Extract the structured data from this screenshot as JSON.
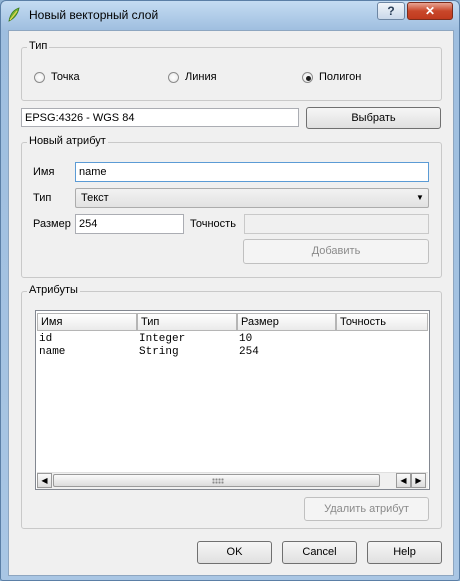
{
  "window": {
    "title": "Новый векторный слой"
  },
  "type_group": {
    "title": "Тип",
    "options": [
      {
        "label": "Точка",
        "selected": false
      },
      {
        "label": "Линия",
        "selected": false
      },
      {
        "label": "Полигон",
        "selected": true
      }
    ]
  },
  "crs": {
    "value": "EPSG:4326 - WGS 84",
    "select_label": "Выбрать"
  },
  "new_attribute": {
    "title": "Новый атрибут",
    "name_label": "Имя",
    "name_value": "name",
    "type_label": "Тип",
    "type_value": "Текст",
    "size_label": "Размер",
    "size_value": "254",
    "precision_label": "Точность",
    "precision_value": "",
    "add_label": "Добавить"
  },
  "attributes": {
    "title": "Атрибуты",
    "columns": [
      "Имя",
      "Тип",
      "Размер",
      "Точность"
    ],
    "rows": [
      [
        "id",
        "Integer",
        "10",
        ""
      ],
      [
        "name",
        "String",
        "254",
        ""
      ]
    ],
    "delete_label": "Удалить атрибут"
  },
  "buttons": {
    "ok": "OK",
    "cancel": "Cancel",
    "help": "Help"
  },
  "colors": {
    "title_bar": "#a9c6e4",
    "close_button": "#c9472a",
    "focus_border": "#5b9bd5"
  }
}
